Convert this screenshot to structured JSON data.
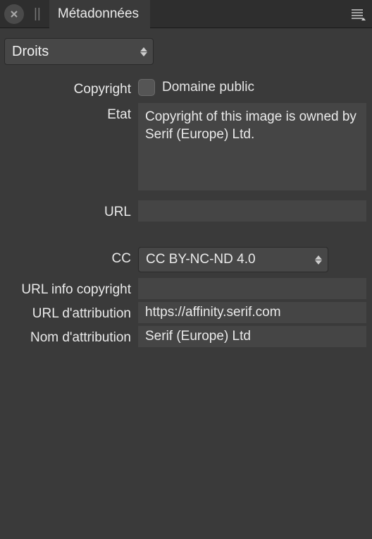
{
  "header": {
    "tab_title": "Métadonnées"
  },
  "section_dropdown": {
    "value": "Droits"
  },
  "form": {
    "copyright_label": "Copyright",
    "public_domain_label": "Domaine public",
    "state_label": "Etat",
    "state_value": "Copyright of this image is owned by Serif (Europe) Ltd.",
    "url_label": "URL",
    "url_value": "",
    "cc_label": "CC",
    "cc_value": "CC BY-NC-ND 4.0",
    "copyright_info_url_label": "URL info copyright",
    "copyright_info_url_value": "",
    "attribution_url_label": "URL d'attribution",
    "attribution_url_value": "https://affinity.serif.com",
    "attribution_name_label": "Nom d'attribution",
    "attribution_name_value": "Serif (Europe) Ltd"
  }
}
